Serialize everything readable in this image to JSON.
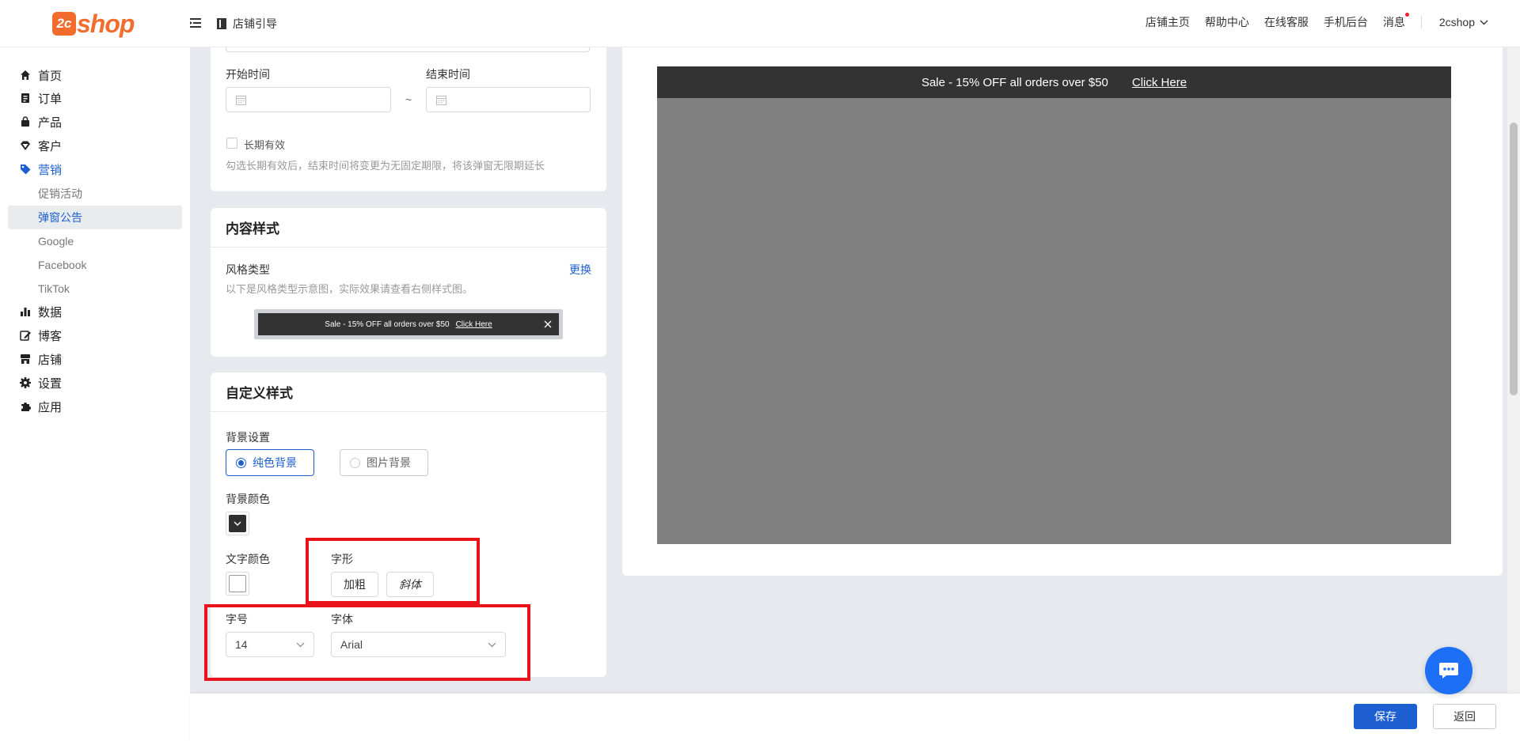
{
  "header": {
    "logo_mark": "2c",
    "logo_text": "shop",
    "breadcrumb": "店铺引导",
    "nav": [
      "店铺主页",
      "帮助中心",
      "在线客服",
      "手机后台",
      "消息"
    ],
    "user": "2cshop"
  },
  "sidebar": {
    "items": [
      {
        "label": "首页",
        "icon": "home-icon"
      },
      {
        "label": "订单",
        "icon": "order-icon"
      },
      {
        "label": "产品",
        "icon": "bag-icon"
      },
      {
        "label": "客户",
        "icon": "diamond-icon"
      },
      {
        "label": "营销",
        "icon": "tag-icon"
      },
      {
        "label": "数据",
        "icon": "bar-chart-icon"
      },
      {
        "label": "博客",
        "icon": "edit-icon"
      },
      {
        "label": "店铺",
        "icon": "store-icon"
      },
      {
        "label": "设置",
        "icon": "gear-icon"
      },
      {
        "label": "应用",
        "icon": "puzzle-icon"
      }
    ],
    "marketing_sub": [
      "促销活动",
      "弹窗公告",
      "Google",
      "Facebook",
      "TikTok"
    ]
  },
  "time_card": {
    "start_label": "开始时间",
    "end_label": "结束时间",
    "separator": "~",
    "long_term_label": "长期有效",
    "long_term_hint": "勾选长期有效后，结束时间将变更为无固定期限，将该弹窗无限期延长"
  },
  "content_style_card": {
    "title": "内容样式",
    "style_type_label": "风格类型",
    "change_link": "更换",
    "style_hint": "以下是风格类型示意图，实际效果请查看右侧样式图。",
    "sample_text": "Sale - 15% OFF all orders over $50",
    "sample_link": "Click Here"
  },
  "custom_style_card": {
    "title": "自定义样式",
    "bg_setting_label": "背景设置",
    "bg_solid": "纯色背景",
    "bg_image": "图片背景",
    "bg_color_label": "背景颜色",
    "bg_color": "#2f2f2f",
    "text_color_label": "文字颜色",
    "text_color": "#ffffff",
    "font_style_label": "字形",
    "bold_label": "加粗",
    "italic_label": "斜体",
    "font_size_label": "字号",
    "font_size_value": "14",
    "font_family_label": "字体",
    "font_family_value": "Arial"
  },
  "preview": {
    "bar_text": "Sale - 15% OFF all orders over $50",
    "bar_link": "Click Here",
    "bar_color": "#333333",
    "body_color": "#808080"
  },
  "footer": {
    "save": "保存",
    "back": "返回"
  },
  "colors": {
    "accent": "#1d5fd1",
    "brand": "#f26d2d",
    "highlight": "#e8131c"
  }
}
